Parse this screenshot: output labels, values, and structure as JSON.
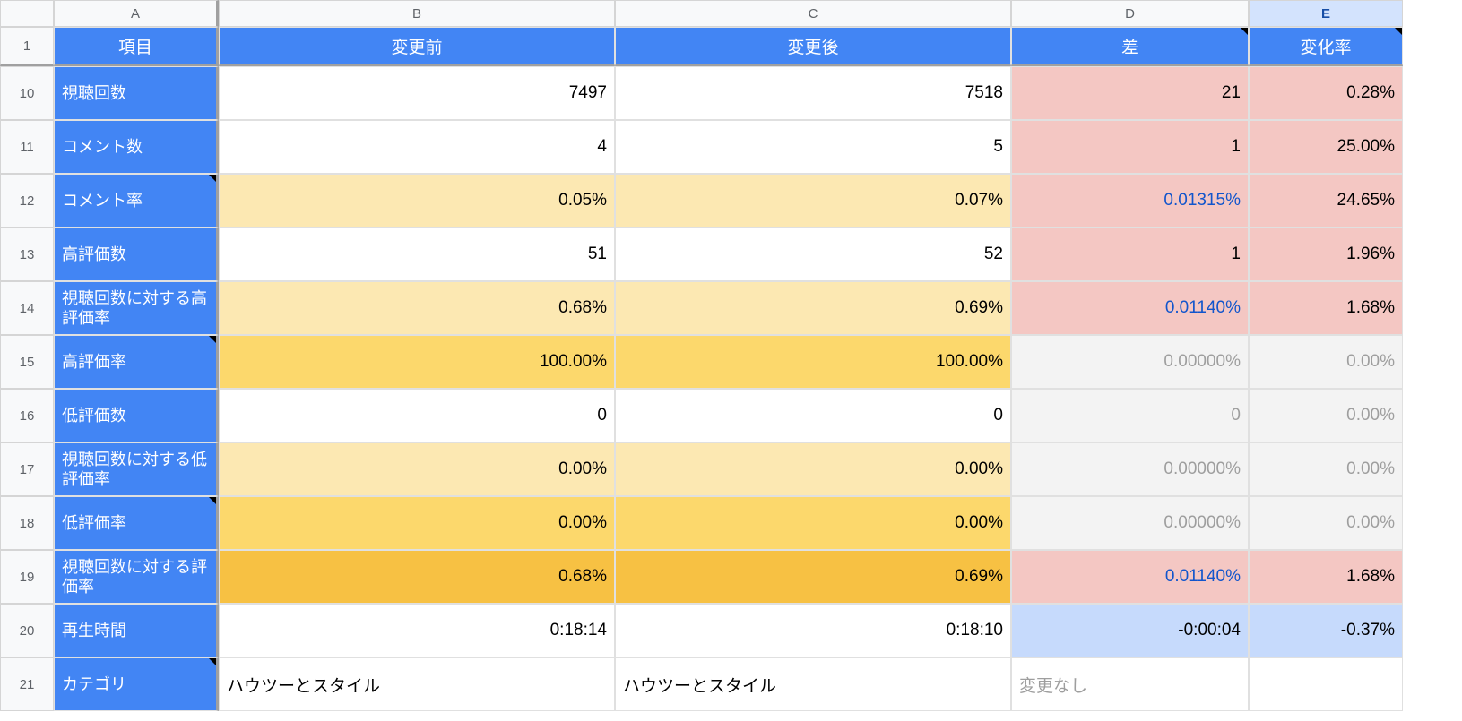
{
  "columns": [
    "A",
    "B",
    "C",
    "D",
    "E"
  ],
  "headerRow": "1",
  "headers": {
    "A": "項目",
    "B": "変更前",
    "C": "変更後",
    "D": "差",
    "E": "変化率"
  },
  "rowNums": [
    "10",
    "11",
    "12",
    "13",
    "14",
    "15",
    "16",
    "17",
    "18",
    "19",
    "20",
    "21"
  ],
  "rows": [
    {
      "label": "視聴回数",
      "b": "7497",
      "c": "7518",
      "d": "21",
      "e": "0.28%"
    },
    {
      "label": "コメント数",
      "b": "4",
      "c": "5",
      "d": "1",
      "e": "25.00%"
    },
    {
      "label": "コメント率",
      "b": "0.05%",
      "c": "0.07%",
      "d": "0.01315%",
      "e": "24.65%"
    },
    {
      "label": "高評価数",
      "b": "51",
      "c": "52",
      "d": "1",
      "e": "1.96%"
    },
    {
      "label": "視聴回数に対する高評価率",
      "b": "0.68%",
      "c": "0.69%",
      "d": "0.01140%",
      "e": "1.68%"
    },
    {
      "label": "高評価率",
      "b": "100.00%",
      "c": "100.00%",
      "d": "0.00000%",
      "e": "0.00%"
    },
    {
      "label": "低評価数",
      "b": "0",
      "c": "0",
      "d": "0",
      "e": "0.00%"
    },
    {
      "label": "視聴回数に対する低評価率",
      "b": "0.00%",
      "c": "0.00%",
      "d": "0.00000%",
      "e": "0.00%"
    },
    {
      "label": "低評価率",
      "b": "0.00%",
      "c": "0.00%",
      "d": "0.00000%",
      "e": "0.00%"
    },
    {
      "label": "視聴回数に対する評価率",
      "b": "0.68%",
      "c": "0.69%",
      "d": "0.01140%",
      "e": "1.68%"
    },
    {
      "label": "再生時間",
      "b": "0:18:14",
      "c": "0:18:10",
      "d": "-0:00:04",
      "e": "-0.37%"
    },
    {
      "label": "カテゴリ",
      "b": "ハウツーとスタイル",
      "c": "ハウツーとスタイル",
      "d": "変更なし",
      "e": ""
    }
  ],
  "styles": {
    "aNote": [
      false,
      false,
      true,
      false,
      false,
      true,
      false,
      false,
      true,
      false,
      false,
      true
    ],
    "bClass": [
      "",
      "",
      "yellow-lt",
      "",
      "yellow-lt",
      "yellow-md",
      "",
      "yellow-lt",
      "yellow-md",
      "yellow-dk",
      "",
      ""
    ],
    "cClass": [
      "",
      "",
      "yellow-lt",
      "",
      "yellow-lt",
      "yellow-md",
      "",
      "yellow-lt",
      "yellow-md",
      "yellow-dk",
      "",
      ""
    ],
    "bAlign": [
      "num",
      "num",
      "num",
      "num",
      "num",
      "num",
      "num",
      "num",
      "num",
      "num",
      "num",
      "txt"
    ],
    "cAlign": [
      "num",
      "num",
      "num",
      "num",
      "num",
      "num",
      "num",
      "num",
      "num",
      "num",
      "num",
      "txt"
    ],
    "dClass": [
      "pink",
      "pink",
      "pink d-blue",
      "pink",
      "pink d-blue",
      "gray",
      "gray",
      "gray",
      "gray",
      "pink d-blue",
      "blue-lt",
      "placeholder"
    ],
    "dAlign": [
      "num",
      "num",
      "num",
      "num",
      "num",
      "num",
      "num",
      "num",
      "num",
      "num",
      "num",
      "txt"
    ],
    "dNote": [
      false,
      false,
      false,
      false,
      false,
      false,
      false,
      false,
      false,
      false,
      false,
      false
    ],
    "eClass": [
      "pink",
      "pink",
      "pink",
      "pink",
      "pink",
      "gray",
      "gray",
      "gray",
      "gray",
      "pink",
      "blue-lt",
      ""
    ],
    "hdrNote": {
      "D": true,
      "E": true
    }
  }
}
